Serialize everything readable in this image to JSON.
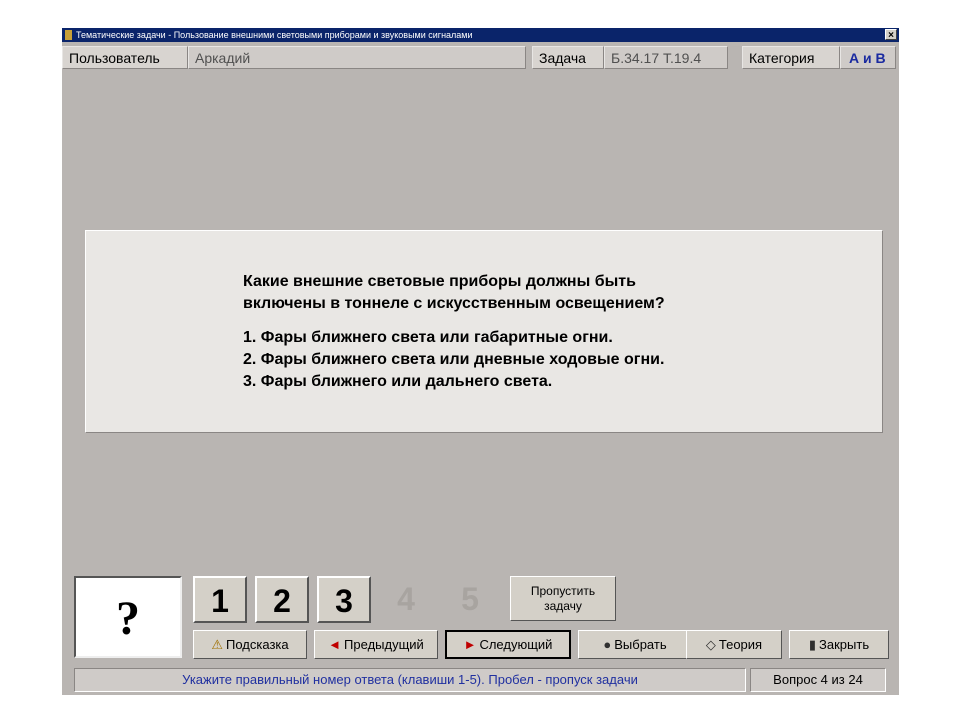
{
  "window": {
    "title": "Тематические задачи - Пользование внешними световыми приборами и звуковыми сигналами",
    "close_glyph": "×"
  },
  "info": {
    "user_label": "Пользователь",
    "user_value": "Аркадий",
    "task_label": "Задача",
    "task_value": "Б.34.17  Т.19.4",
    "category_label": "Категория",
    "category_value": "А и В",
    "category_color": "#1a2aa0"
  },
  "question": {
    "lines": [
      "Какие внешние световые приборы должны быть",
      "включены в тоннеле с искусственным освещением?"
    ],
    "answers": [
      "1. Фары ближнего света или габаритные огни.",
      "2. Фары ближнего света или дневные ходовые огни.",
      "3. Фары ближнего или дальнего света."
    ]
  },
  "answer_box": "?",
  "number_buttons": [
    {
      "label": "1",
      "enabled": true
    },
    {
      "label": "2",
      "enabled": true
    },
    {
      "label": "3",
      "enabled": true
    },
    {
      "label": "4",
      "enabled": false
    },
    {
      "label": "5",
      "enabled": false
    }
  ],
  "skip_button": {
    "line1": "Пропустить",
    "line2": "задачу"
  },
  "actions": [
    {
      "label": "Подсказка",
      "icon": "hint-icon",
      "glyph": "⚠"
    },
    {
      "label": "Предыдущий",
      "icon": "arrow-left-icon",
      "glyph": "◄"
    },
    {
      "label": "Следующий",
      "icon": "arrow-right-icon",
      "glyph": "►"
    },
    {
      "label": "Выбрать",
      "icon": "select-icon",
      "glyph": "●"
    },
    {
      "label": "Теория",
      "icon": "theory-icon",
      "glyph": "◇"
    },
    {
      "label": "Закрыть",
      "icon": "exit-icon",
      "glyph": "▮"
    }
  ],
  "status": {
    "hint": "Укажите правильный номер ответа (клавиши 1-5). Пробел - пропуск задачи",
    "counter": "Вопрос 4 из 24"
  }
}
